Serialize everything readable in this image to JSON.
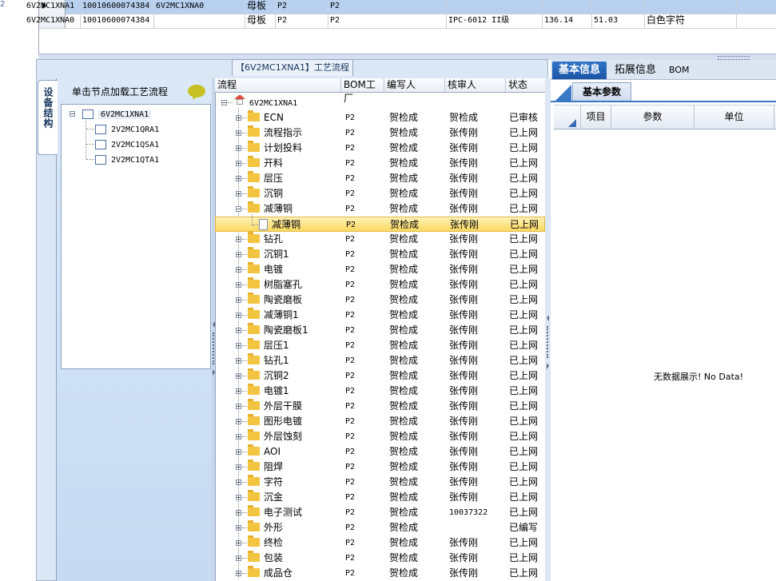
{
  "edge_label": "2",
  "top_grid": {
    "rows": [
      {
        "c1": "6V2MC1XNA1",
        "c2": "10010600074384",
        "c3": "6V2MC1XNA0",
        "c4": "母板",
        "c5": "P2",
        "c6": "P2",
        "c7": "",
        "c8": "",
        "c9": "",
        "c10": "",
        "selected": true
      },
      {
        "c1": "6V2MC1XNA0",
        "c2": "10010600074384",
        "c3": "",
        "c4": "母板",
        "c5": "P2",
        "c6": "P2",
        "c7": "IPC-6012 II级",
        "c8": "136.14",
        "c9": "51.03",
        "c10": "白色字符",
        "selected": false
      }
    ]
  },
  "panel_title": "【6V2MC1XNA1】工艺流程",
  "vertical_tab": "设备结构",
  "left_panel": {
    "header": "单击节点加载工艺流程",
    "tree": {
      "root": "6V2MC1XNA1",
      "children": [
        "2V2MC1QRA1",
        "2V2MC1QSA1",
        "2V2MC1QTA1"
      ]
    }
  },
  "center": {
    "columns": [
      "流程",
      "BOM工厂",
      "编写人",
      "核审人",
      "状态"
    ],
    "root": "6V2MC1XNA1",
    "rows": [
      {
        "name": "ECN",
        "bom": "P2",
        "writer": "贺检成",
        "reviewer": "贺检成",
        "status": "已审核"
      },
      {
        "name": "流程指示",
        "bom": "P2",
        "writer": "贺检成",
        "reviewer": "张传刚",
        "status": "已上网"
      },
      {
        "name": "计划投料",
        "bom": "P2",
        "writer": "贺检成",
        "reviewer": "张传刚",
        "status": "已上网"
      },
      {
        "name": "开料",
        "bom": "P2",
        "writer": "贺检成",
        "reviewer": "张传刚",
        "status": "已上网"
      },
      {
        "name": "层压",
        "bom": "P2",
        "writer": "贺检成",
        "reviewer": "张传刚",
        "status": "已上网"
      },
      {
        "name": "沉铜",
        "bom": "P2",
        "writer": "贺检成",
        "reviewer": "张传刚",
        "status": "已上网"
      },
      {
        "name": "减薄铜",
        "bom": "P2",
        "writer": "贺检成",
        "reviewer": "张传刚",
        "status": "已上网",
        "expanded": true
      },
      {
        "name": "减薄铜",
        "bom": "P2",
        "writer": "贺检成",
        "reviewer": "张传刚",
        "status": "已上网",
        "child": true
      },
      {
        "name": "钻孔",
        "bom": "P2",
        "writer": "贺检成",
        "reviewer": "张传刚",
        "status": "已上网"
      },
      {
        "name": "沉铜1",
        "bom": "P2",
        "writer": "贺检成",
        "reviewer": "张传刚",
        "status": "已上网"
      },
      {
        "name": "电镀",
        "bom": "P2",
        "writer": "贺检成",
        "reviewer": "张传刚",
        "status": "已上网"
      },
      {
        "name": "树脂塞孔",
        "bom": "P2",
        "writer": "贺检成",
        "reviewer": "张传刚",
        "status": "已上网"
      },
      {
        "name": "陶瓷磨板",
        "bom": "P2",
        "writer": "贺检成",
        "reviewer": "张传刚",
        "status": "已上网"
      },
      {
        "name": "减薄铜1",
        "bom": "P2",
        "writer": "贺检成",
        "reviewer": "张传刚",
        "status": "已上网"
      },
      {
        "name": "陶瓷磨板1",
        "bom": "P2",
        "writer": "贺检成",
        "reviewer": "张传刚",
        "status": "已上网"
      },
      {
        "name": "层压1",
        "bom": "P2",
        "writer": "贺检成",
        "reviewer": "张传刚",
        "status": "已上网"
      },
      {
        "name": "钻孔1",
        "bom": "P2",
        "writer": "贺检成",
        "reviewer": "张传刚",
        "status": "已上网"
      },
      {
        "name": "沉铜2",
        "bom": "P2",
        "writer": "贺检成",
        "reviewer": "张传刚",
        "status": "已上网"
      },
      {
        "name": "电镀1",
        "bom": "P2",
        "writer": "贺检成",
        "reviewer": "张传刚",
        "status": "已上网"
      },
      {
        "name": "外层干膜",
        "bom": "P2",
        "writer": "贺检成",
        "reviewer": "张传刚",
        "status": "已上网"
      },
      {
        "name": "图形电镀",
        "bom": "P2",
        "writer": "贺检成",
        "reviewer": "张传刚",
        "status": "已上网"
      },
      {
        "name": "外层蚀刻",
        "bom": "P2",
        "writer": "贺检成",
        "reviewer": "张传刚",
        "status": "已上网"
      },
      {
        "name": "AOI",
        "bom": "P2",
        "writer": "贺检成",
        "reviewer": "张传刚",
        "status": "已上网"
      },
      {
        "name": "阻焊",
        "bom": "P2",
        "writer": "贺检成",
        "reviewer": "张传刚",
        "status": "已上网"
      },
      {
        "name": "字符",
        "bom": "P2",
        "writer": "贺检成",
        "reviewer": "张传刚",
        "status": "已上网"
      },
      {
        "name": "沉金",
        "bom": "P2",
        "writer": "贺检成",
        "reviewer": "张传刚",
        "status": "已上网"
      },
      {
        "name": "电子测试",
        "bom": "P2",
        "writer": "贺检成",
        "reviewer": "10037322",
        "status": "已上网"
      },
      {
        "name": "外形",
        "bom": "P2",
        "writer": "贺检成",
        "reviewer": "",
        "status": "已编写"
      },
      {
        "name": "终检",
        "bom": "P2",
        "writer": "贺检成",
        "reviewer": "张传刚",
        "status": "已上网"
      },
      {
        "name": "包装",
        "bom": "P2",
        "writer": "贺检成",
        "reviewer": "张传刚",
        "status": "已上网"
      },
      {
        "name": "成品仓",
        "bom": "P2",
        "writer": "贺检成",
        "reviewer": "张传刚",
        "status": "已上网"
      }
    ]
  },
  "right_panel": {
    "tabs": [
      "基本信息",
      "拓展信息",
      "BOM"
    ],
    "subtab": "基本参数",
    "columns": [
      "项目",
      "参数",
      "单位"
    ],
    "empty_text": "无数据展示! No Data!"
  },
  "colors": {
    "accent": "#1b55a6",
    "selection_row": "#b8d0f0",
    "highlight": "#fbd860",
    "panel_bg": "#dce7f5"
  }
}
